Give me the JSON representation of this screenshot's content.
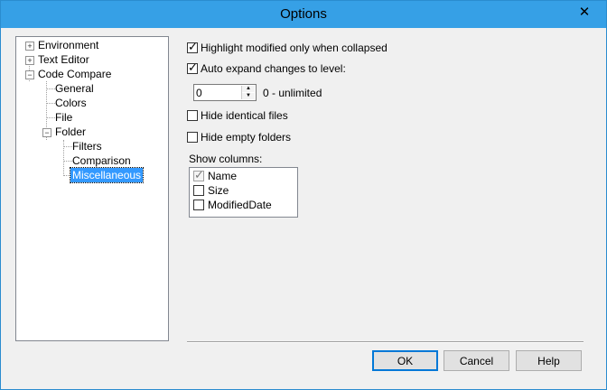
{
  "window": {
    "title": "Options"
  },
  "tree": {
    "environment": "Environment",
    "text_editor": "Text Editor",
    "code_compare": "Code Compare",
    "general": "General",
    "colors": "Colors",
    "file": "File",
    "folder": "Folder",
    "filters": "Filters",
    "comparison": "Comparison",
    "miscellaneous": "Miscellaneous",
    "expand_plus": "+",
    "expand_minus": "−"
  },
  "settings": {
    "highlight_modified": {
      "label": "Highlight modified only when collapsed",
      "checked": true
    },
    "auto_expand": {
      "label": "Auto expand changes to level:",
      "checked": true
    },
    "level_value": "0",
    "level_hint": "0 - unlimited",
    "hide_identical": {
      "label": "Hide identical files",
      "checked": false
    },
    "hide_empty": {
      "label": "Hide empty folders",
      "checked": false
    },
    "show_columns_label": "Show columns:",
    "columns": [
      {
        "label": "Name",
        "checked": true,
        "disabled": true
      },
      {
        "label": "Size",
        "checked": false,
        "disabled": false
      },
      {
        "label": "ModifiedDate",
        "checked": false,
        "disabled": false
      }
    ]
  },
  "buttons": {
    "ok": "OK",
    "cancel": "Cancel",
    "help": "Help"
  },
  "glyphs": {
    "close": "✕",
    "check": "✓",
    "spin_up": "▲",
    "spin_down": "▼"
  }
}
